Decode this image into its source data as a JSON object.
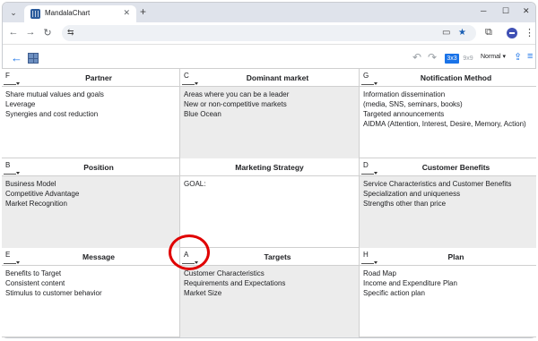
{
  "browser": {
    "tab_title": "MandalaChart",
    "tab_close": "✕",
    "new_tab": "+",
    "window_min": "─",
    "window_max": "☐",
    "window_close": "✕"
  },
  "toolbar": {
    "mode_3x3": "3x3",
    "mode_9x9": "9x9",
    "view_select": "Normal"
  },
  "grid": {
    "cells": [
      {
        "letter": "F",
        "title": "Partner",
        "shaded": false,
        "lines": [
          "Share mutual values and goals",
          "Leverage",
          "Synergies and cost reduction"
        ]
      },
      {
        "letter": "C",
        "title": "Dominant market",
        "shaded": true,
        "lines": [
          "Areas where you can be a leader",
          "New or non-competitive markets",
          "Blue Ocean"
        ]
      },
      {
        "letter": "G",
        "title": "Notification Method",
        "shaded": false,
        "lines": [
          "Information dissemination",
          "(media, SNS, seminars, books)",
          "Targeted announcements",
          "AIDMA (Attention, Interest, Desire, Memory, Action)"
        ]
      },
      {
        "letter": "B",
        "title": "Position",
        "shaded": true,
        "lines": [
          "Business Model",
          "Competitive Advantage",
          "Market Recognition"
        ]
      },
      {
        "letter": "",
        "title": "Marketing Strategy",
        "shaded": false,
        "lines": [
          "GOAL:"
        ]
      },
      {
        "letter": "D",
        "title": "Customer Benefits",
        "shaded": true,
        "lines": [
          "Service Characteristics and Customer Benefits",
          "Specialization and uniqueness",
          "Strengths other than price"
        ]
      },
      {
        "letter": "E",
        "title": "Message",
        "shaded": false,
        "lines": [
          "Benefits to Target",
          "Consistent content",
          "Stimulus to customer behavior"
        ]
      },
      {
        "letter": "A",
        "title": "Targets",
        "shaded": true,
        "lines": [
          "Customer Characteristics",
          "Requirements and Expectations",
          "Market Size"
        ]
      },
      {
        "letter": "H",
        "title": "Plan",
        "shaded": false,
        "lines": [
          "Road Map",
          "Income and Expenditure Plan",
          "Specific action plan"
        ]
      }
    ]
  },
  "colors": {
    "accent": "#1a73e8",
    "shaded_cell": "#ececec",
    "highlight": "#e00000"
  }
}
